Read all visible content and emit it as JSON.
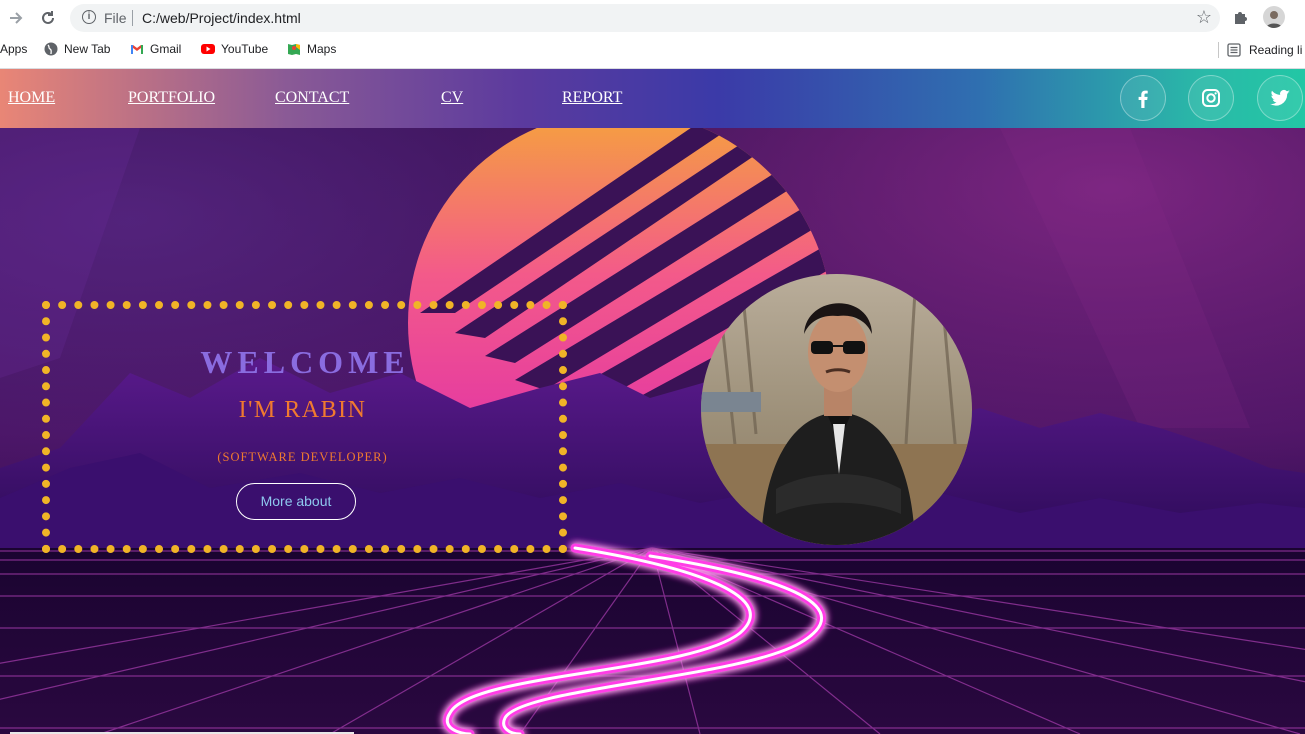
{
  "browser": {
    "file_label": "File",
    "url": "C:/web/Project/index.html",
    "bookmarks": [
      {
        "label": "Apps",
        "icon": "apps-icon"
      },
      {
        "label": "New Tab",
        "icon": "globe-icon"
      },
      {
        "label": "Gmail",
        "icon": "gmail-icon"
      },
      {
        "label": "YouTube",
        "icon": "youtube-icon"
      },
      {
        "label": "Maps",
        "icon": "maps-icon"
      }
    ],
    "reading_list": "Reading li"
  },
  "nav": {
    "links": [
      "HOME",
      "PORTFOLIO",
      "CONTACT",
      "CV",
      "REPORT"
    ],
    "social": [
      "facebook-icon",
      "instagram-icon",
      "twitter-icon"
    ]
  },
  "hero": {
    "welcome": "WELCOME",
    "name": "I'M RABIN",
    "role": "(SOFTWARE DEVELOPER)",
    "button": "More about"
  },
  "colors": {
    "dots": "#f0b427",
    "welcome": "#8a6ce0",
    "name": "#f07a2f",
    "button_text": "#8ec8ee"
  }
}
